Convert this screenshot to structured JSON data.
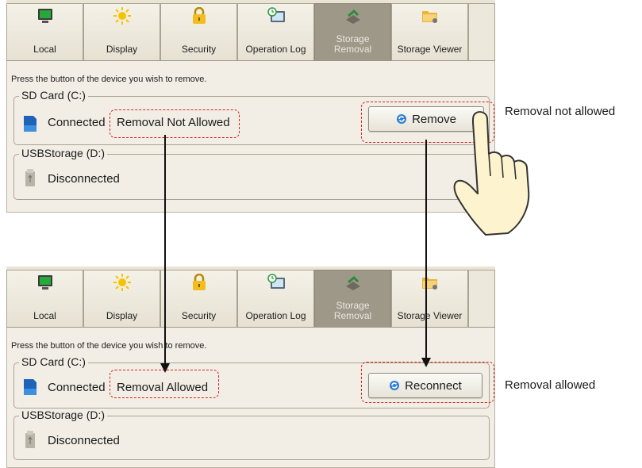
{
  "tabs": [
    {
      "icon": "monitor-icon",
      "label": "Local"
    },
    {
      "icon": "sun-icon",
      "label": "Display"
    },
    {
      "icon": "lock-icon",
      "label": "Security"
    },
    {
      "icon": "clock-log-icon",
      "label": "Operation Log"
    },
    {
      "icon": "storage-eject-icon",
      "label": "Storage Removal"
    },
    {
      "icon": "folder-storage-icon",
      "label": "Storage Viewer"
    }
  ],
  "active_tab": "Storage Removal",
  "before": {
    "hint": "Press the button of the device you wish to remove.",
    "sd_group": "SD Card (C:)",
    "sd_status": "Connected",
    "sd_removal": "Removal Not Allowed",
    "sd_button": "Remove",
    "usb_group": "USBStorage (D:)",
    "usb_status": "Disconnected"
  },
  "after": {
    "hint": "Press the button of the device you wish to remove.",
    "sd_group": "SD Card (C:)",
    "sd_status": "Connected",
    "sd_removal": "Removal Allowed",
    "sd_button": "Reconnect",
    "usb_group": "USBStorage (D:)",
    "usb_status": "Disconnected"
  },
  "annotations": {
    "before_note": "Removal not allowed",
    "after_note": "Removal allowed"
  },
  "colors": {
    "highlight": "#d62020",
    "active_tab": "#9e9889",
    "panel_bg": "#f2eee5"
  }
}
